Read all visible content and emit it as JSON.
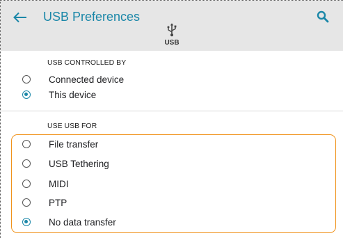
{
  "header": {
    "title": "USB Preferences",
    "back_icon": "arrow-left-icon",
    "search_icon": "search-icon",
    "usb_icon": "usb-icon",
    "usb_label": "USB"
  },
  "controlled_by": {
    "header": "USB CONTROLLED BY",
    "options": [
      {
        "label": "Connected device",
        "selected": false
      },
      {
        "label": "This device",
        "selected": true
      }
    ]
  },
  "use_for": {
    "header": "USE USB FOR",
    "options": [
      {
        "label": "File transfer",
        "selected": false
      },
      {
        "label": "USB Tethering",
        "selected": false
      },
      {
        "label": "MIDI",
        "selected": false
      },
      {
        "label": "PTP",
        "selected": false
      },
      {
        "label": "No data transfer",
        "selected": true
      }
    ]
  },
  "colors": {
    "accent": "#1a87a8",
    "appbar_bg": "#e6e6e6",
    "highlight": "#f0931c"
  }
}
